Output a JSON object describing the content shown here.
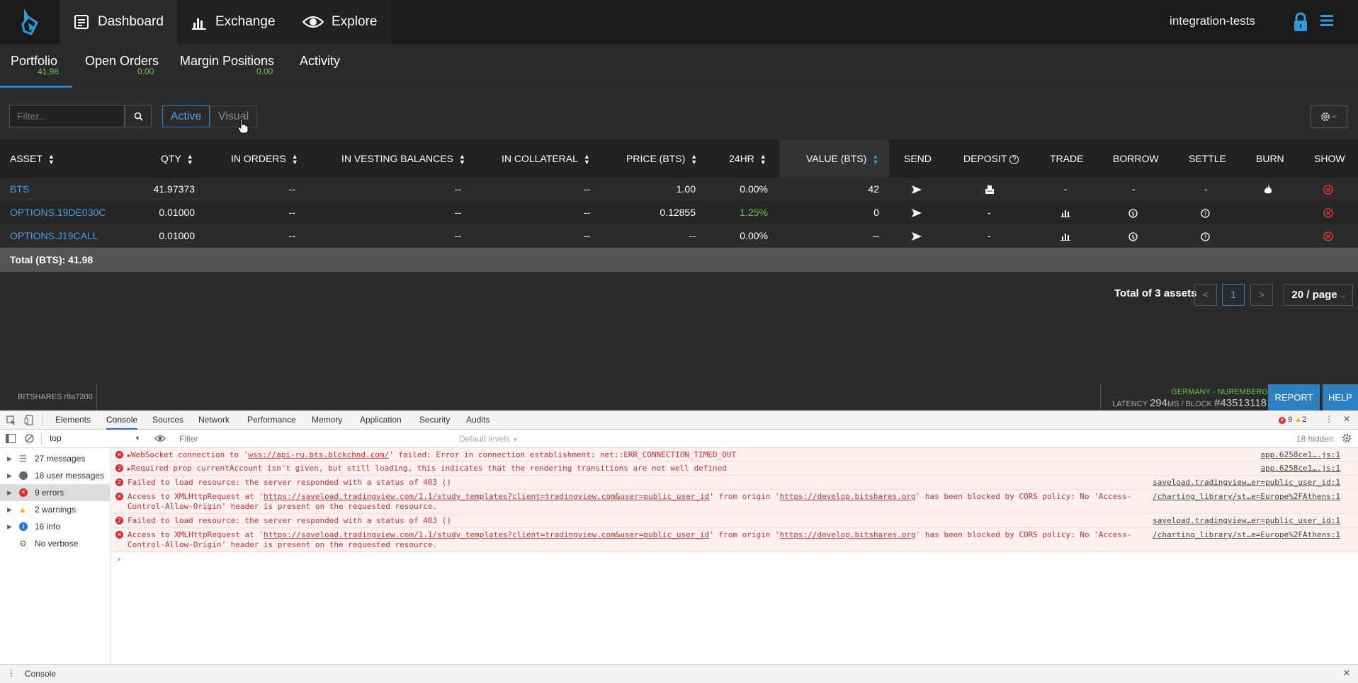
{
  "nav": {
    "dashboard": "Dashboard",
    "exchange": "Exchange",
    "explore": "Explore",
    "account": "integration-tests"
  },
  "subtabs": [
    {
      "label": "Portfolio",
      "value": "41.98"
    },
    {
      "label": "Open Orders",
      "value": "0.00"
    },
    {
      "label": "Margin Positions",
      "value": "0.00"
    },
    {
      "label": "Activity",
      "value": ""
    }
  ],
  "filter": {
    "placeholder": "Filter..."
  },
  "segments": {
    "active": "Active",
    "visual": "Visual"
  },
  "table": {
    "headers": {
      "asset": "ASSET",
      "qty": "QTY",
      "in_orders": "IN ORDERS",
      "in_vesting": "IN VESTING BALANCES",
      "in_collateral": "IN COLLATERAL",
      "price": "PRICE (BTS)",
      "hr24": "24HR",
      "value": "VALUE (BTS)",
      "send": "SEND",
      "deposit": "DEPOSIT",
      "trade": "TRADE",
      "borrow": "BORROW",
      "settle": "SETTLE",
      "burn": "BURN",
      "show": "SHOW"
    },
    "rows": [
      {
        "asset": "BTS",
        "qty": "41.97373",
        "in_orders": "--",
        "in_vesting": "--",
        "in_collateral": "--",
        "price": "1.00",
        "hr24": "0.00%",
        "value": "42",
        "trade": "-",
        "borrow": "-",
        "settle": "-"
      },
      {
        "asset": "OPTIONS.19DE030C",
        "qty": "0.01000",
        "in_orders": "--",
        "in_vesting": "--",
        "in_collateral": "--",
        "price": "0.12855",
        "hr24": "1.25%",
        "value": "0",
        "deposit": "-"
      },
      {
        "asset": "OPTIONS.J19CALL",
        "qty": "0.01000",
        "in_orders": "--",
        "in_vesting": "--",
        "in_collateral": "--",
        "price": "--",
        "hr24": "0.00%",
        "value": "--",
        "deposit": "-"
      }
    ],
    "total": "Total (BTS): 41.98"
  },
  "pagination": {
    "total": "Total of 3 assets",
    "current": "1",
    "prev": "<",
    "next": ">",
    "page_size": "20 / page"
  },
  "status": {
    "version": "BITSHARES r9a7200",
    "node": "GERMANY - NUREMBERG",
    "latency_label": "LATENCY",
    "latency_value": "294",
    "latency_unit": "MS",
    "block_label": "/ BLOCK",
    "block_value": "#43513118",
    "report": "REPORT",
    "help": "HELP"
  },
  "devtools": {
    "tabs": [
      "Elements",
      "Console",
      "Sources",
      "Network",
      "Performance",
      "Memory",
      "Application",
      "Security",
      "Audits"
    ],
    "error_count": "9",
    "warning_count": "2",
    "context": "top",
    "filter_placeholder": "Filter",
    "levels": "Default levels",
    "hidden": "18 hidden",
    "sidebar": [
      {
        "label": "27 messages"
      },
      {
        "label": "18 user messages"
      },
      {
        "label": "9 errors"
      },
      {
        "label": "2 warnings"
      },
      {
        "label": "16 info"
      },
      {
        "label": "No verbose"
      }
    ],
    "messages": [
      {
        "text_a": "WebSocket connection to '",
        "link": "wss://api-ru.bts.blckchnd.com/",
        "text_b": "' failed: Error in connection establishment: net::ERR_CONNECTION_TIMED_OUT",
        "src": "app.6258ce1….js:1"
      },
      {
        "text_a": "Required prop currentAccount isn't given, but still loading, this indicates that the rendering transitions are not well defined",
        "src": "app.6258ce1….js:1"
      },
      {
        "text_a": "Failed to load resource: the server responded with a status of 403 ()",
        "src": "saveload.tradingview…er=public_user_id:1"
      },
      {
        "line1_a": "Access to XMLHttpRequest at '",
        "line1_link": "https://saveload.tradingview.com/1.1/study_templates?client=tradingview.com&user=public_user_id",
        "line1_b": "' from origin '",
        "line1_link2": "https://develop.bitshares.org",
        "line1_c": "' has been blocked by CORS policy: No 'Access-",
        "line2": "Control-Allow-Origin' header is present on the requested resource.",
        "src": "/charting_library/st…e=Europe%2FAthens:1"
      },
      {
        "text_a": "Failed to load resource: the server responded with a status of 403 ()",
        "src": "saveload.tradingview…er=public_user_id:1"
      },
      {
        "line1_a": "Access to XMLHttpRequest at '",
        "line1_link": "https://saveload.tradingview.com/1.1/study_templates?client=tradingview.com&user=public_user_id",
        "line1_b": "' from origin '",
        "line1_link2": "https://develop.bitshares.org",
        "line1_c": "' has been blocked by CORS policy: No 'Access-",
        "line2": "Control-Allow-Origin' header is present on the requested resource.",
        "src": "/charting_library/st…e=Europe%2FAthens:1"
      }
    ],
    "badge_2": "2",
    "prompt": "›",
    "drawer": "Console"
  },
  "colors": {
    "accent": "#2d80c2",
    "positive": "#6cc644",
    "error": "#d32f2f"
  }
}
